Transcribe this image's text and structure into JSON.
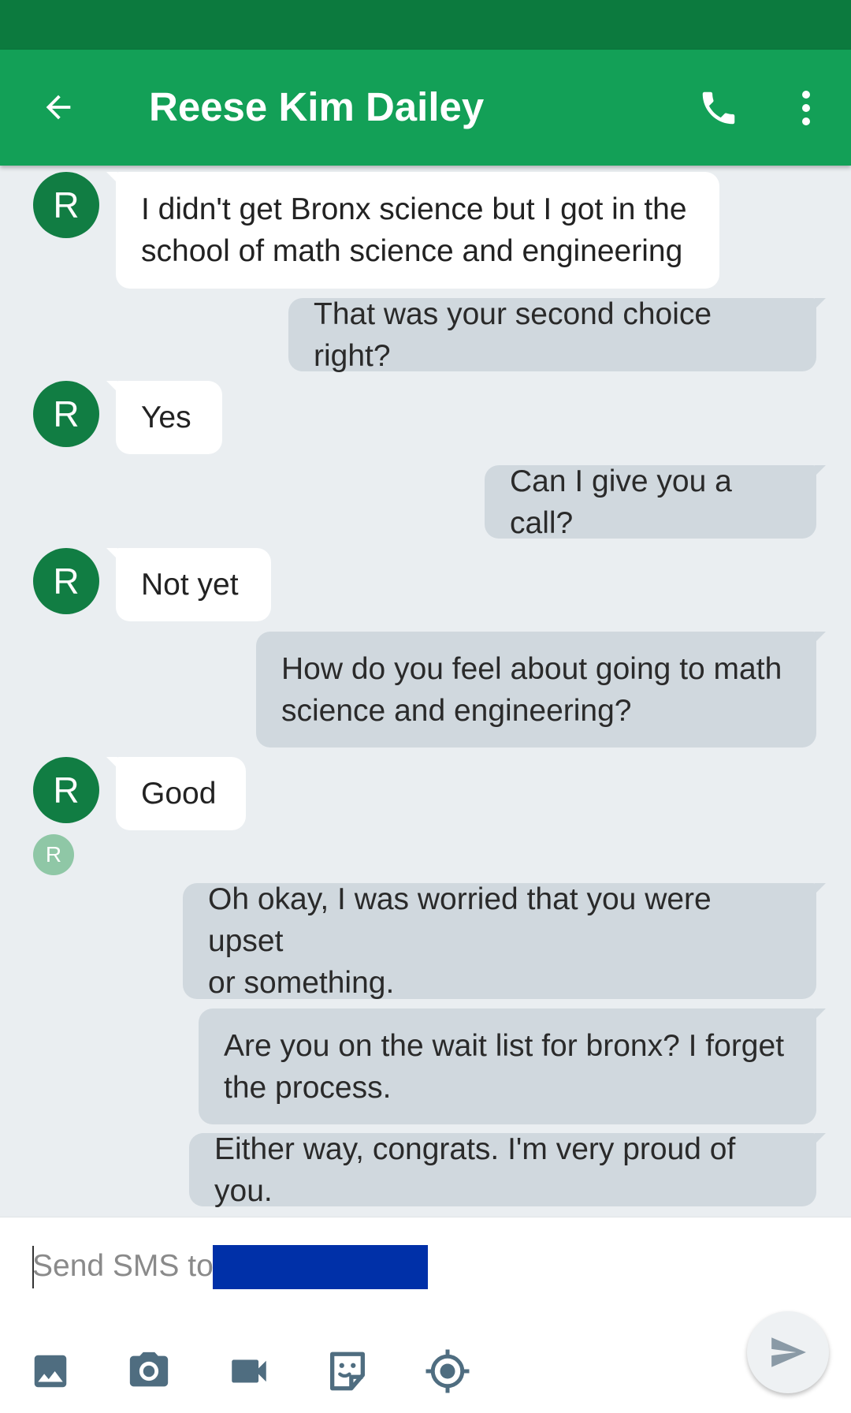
{
  "header": {
    "title": "Reese Kim Dailey",
    "back_icon": "arrow-back-icon",
    "call_icon": "phone-icon",
    "more_icon": "more-vert-icon",
    "colors": {
      "status_bar": "#0c7a3e",
      "app_bar": "#13a057",
      "avatar": "#117d43"
    }
  },
  "thread": {
    "contact_initial": "R",
    "messages": [
      {
        "direction": "incoming",
        "lines": [
          "I didn't get Bronx science but I got in the",
          "school of math science and engineering"
        ]
      },
      {
        "direction": "outgoing",
        "lines": [
          "That was your second choice right?"
        ]
      },
      {
        "direction": "incoming",
        "lines": [
          "Yes"
        ]
      },
      {
        "direction": "outgoing",
        "lines": [
          "Can I give you a call?"
        ]
      },
      {
        "direction": "incoming",
        "lines": [
          "Not yet"
        ]
      },
      {
        "direction": "outgoing",
        "lines": [
          "How do you feel about going to math",
          "science and engineering?"
        ]
      },
      {
        "direction": "incoming",
        "lines": [
          "Good"
        ]
      },
      {
        "direction": "outgoing",
        "lines": [
          "Oh okay, I was worried that you were upset",
          "or something."
        ]
      },
      {
        "direction": "outgoing",
        "lines": [
          "Are you on the wait list for bronx? I forget",
          "the process."
        ]
      },
      {
        "direction": "outgoing",
        "lines": [
          "Either way, congrats. I'm very proud of you."
        ]
      }
    ],
    "read_receipt_initial": "R"
  },
  "compose": {
    "placeholder": "Send SMS to",
    "value": "",
    "tools": [
      "image-icon",
      "camera-icon",
      "video-icon",
      "sticker-icon",
      "location-icon"
    ],
    "send_icon": "send-icon"
  }
}
